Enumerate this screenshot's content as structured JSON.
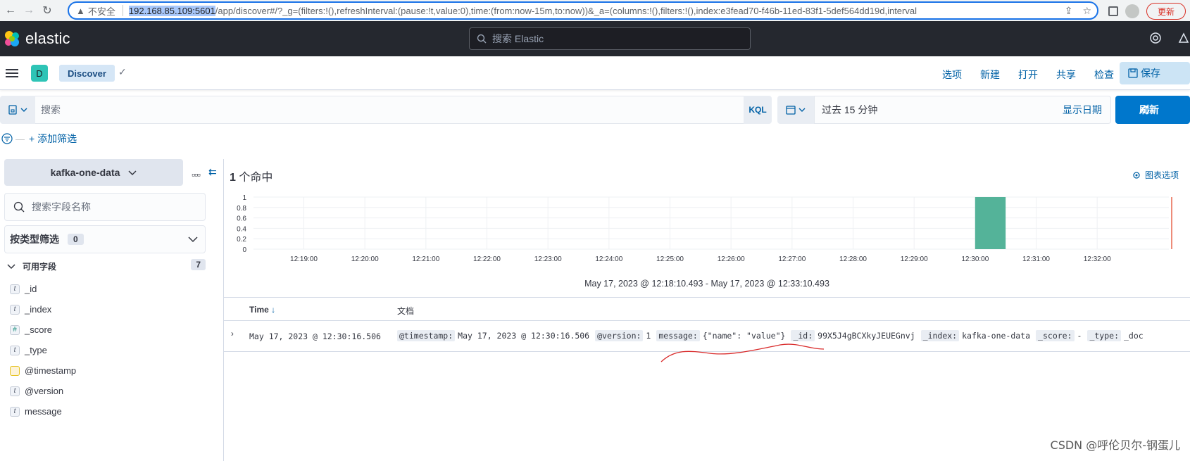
{
  "browser": {
    "insecure_label": "不安全",
    "url_host": "192.168.85.109:5601",
    "url_rest": "/app/discover#/?_g=(filters:!(),refreshInterval:(pause:!t,value:0),time:(from:now-15m,to:now))&_a=(columns:!(),filters:!(),index:e3fead70-f46b-11ed-83f1-5def564dd19d,interval",
    "update_label": "更新"
  },
  "header": {
    "brand": "elastic",
    "search_placeholder": "搜索 Elastic"
  },
  "appbar": {
    "space_initial": "D",
    "breadcrumb": "Discover",
    "links": [
      "选项",
      "新建",
      "打开",
      "共享",
      "检查"
    ],
    "save_label": "保存"
  },
  "query": {
    "placeholder": "搜索",
    "language": "KQL",
    "date_range": "过去 15 分钟",
    "show_dates": "显示日期",
    "refresh_label": "刷新",
    "add_filter": "+ 添加筛选"
  },
  "sidebar": {
    "index_pattern": "kafka-one-data",
    "field_search_placeholder": "搜索字段名称",
    "type_filter_label": "按类型筛选",
    "type_filter_count": "0",
    "available_label": "可用字段",
    "available_count": "7",
    "fields": [
      {
        "type": "t",
        "name": "_id"
      },
      {
        "type": "t",
        "name": "_index"
      },
      {
        "type": "#",
        "name": "_score"
      },
      {
        "type": "t",
        "name": "_type"
      },
      {
        "type": "date",
        "name": "@timestamp"
      },
      {
        "type": "t",
        "name": "@version"
      },
      {
        "type": "t",
        "name": "message"
      }
    ]
  },
  "main": {
    "hits_count": "1",
    "hits_label": "个命中",
    "chart_options": "图表选项",
    "time_range": "May 17, 2023 @ 12:18:10.493 - May 17, 2023 @ 12:33:10.493",
    "table": {
      "col_time": "Time",
      "col_doc": "文档",
      "row_time": "May 17, 2023 @ 12:30:16.506",
      "row_fields": [
        {
          "k": "@timestamp:",
          "v": "May 17, 2023 @ 12:30:16.506"
        },
        {
          "k": "@version:",
          "v": "1"
        },
        {
          "k": "message:",
          "v": "{\"name\": \"value\"}"
        },
        {
          "k": "_id:",
          "v": "99X5J4gBCXkyJEUEGnvj"
        },
        {
          "k": "_index:",
          "v": "kafka-one-data"
        },
        {
          "k": "_score:",
          "v": " -"
        },
        {
          "k": "_type:",
          "v": "_doc"
        }
      ]
    }
  },
  "chart_data": {
    "type": "bar",
    "x": [
      "12:19:00",
      "12:20:00",
      "12:21:00",
      "12:22:00",
      "12:23:00",
      "12:24:00",
      "12:25:00",
      "12:26:00",
      "12:27:00",
      "12:28:00",
      "12:29:00",
      "12:30:00",
      "12:31:00",
      "12:32:00"
    ],
    "y_ticks": [
      "1",
      "0.8",
      "0.6",
      "0.4",
      "0.2",
      "0"
    ],
    "ylim": [
      0,
      1
    ],
    "bars": [
      {
        "x": "12:30:00",
        "value": 1
      }
    ],
    "bar_color": "#54b399",
    "now_marker_color": "#e7664c",
    "grid": true
  },
  "watermark": "CSDN @呼伦贝尔-钢蛋儿"
}
